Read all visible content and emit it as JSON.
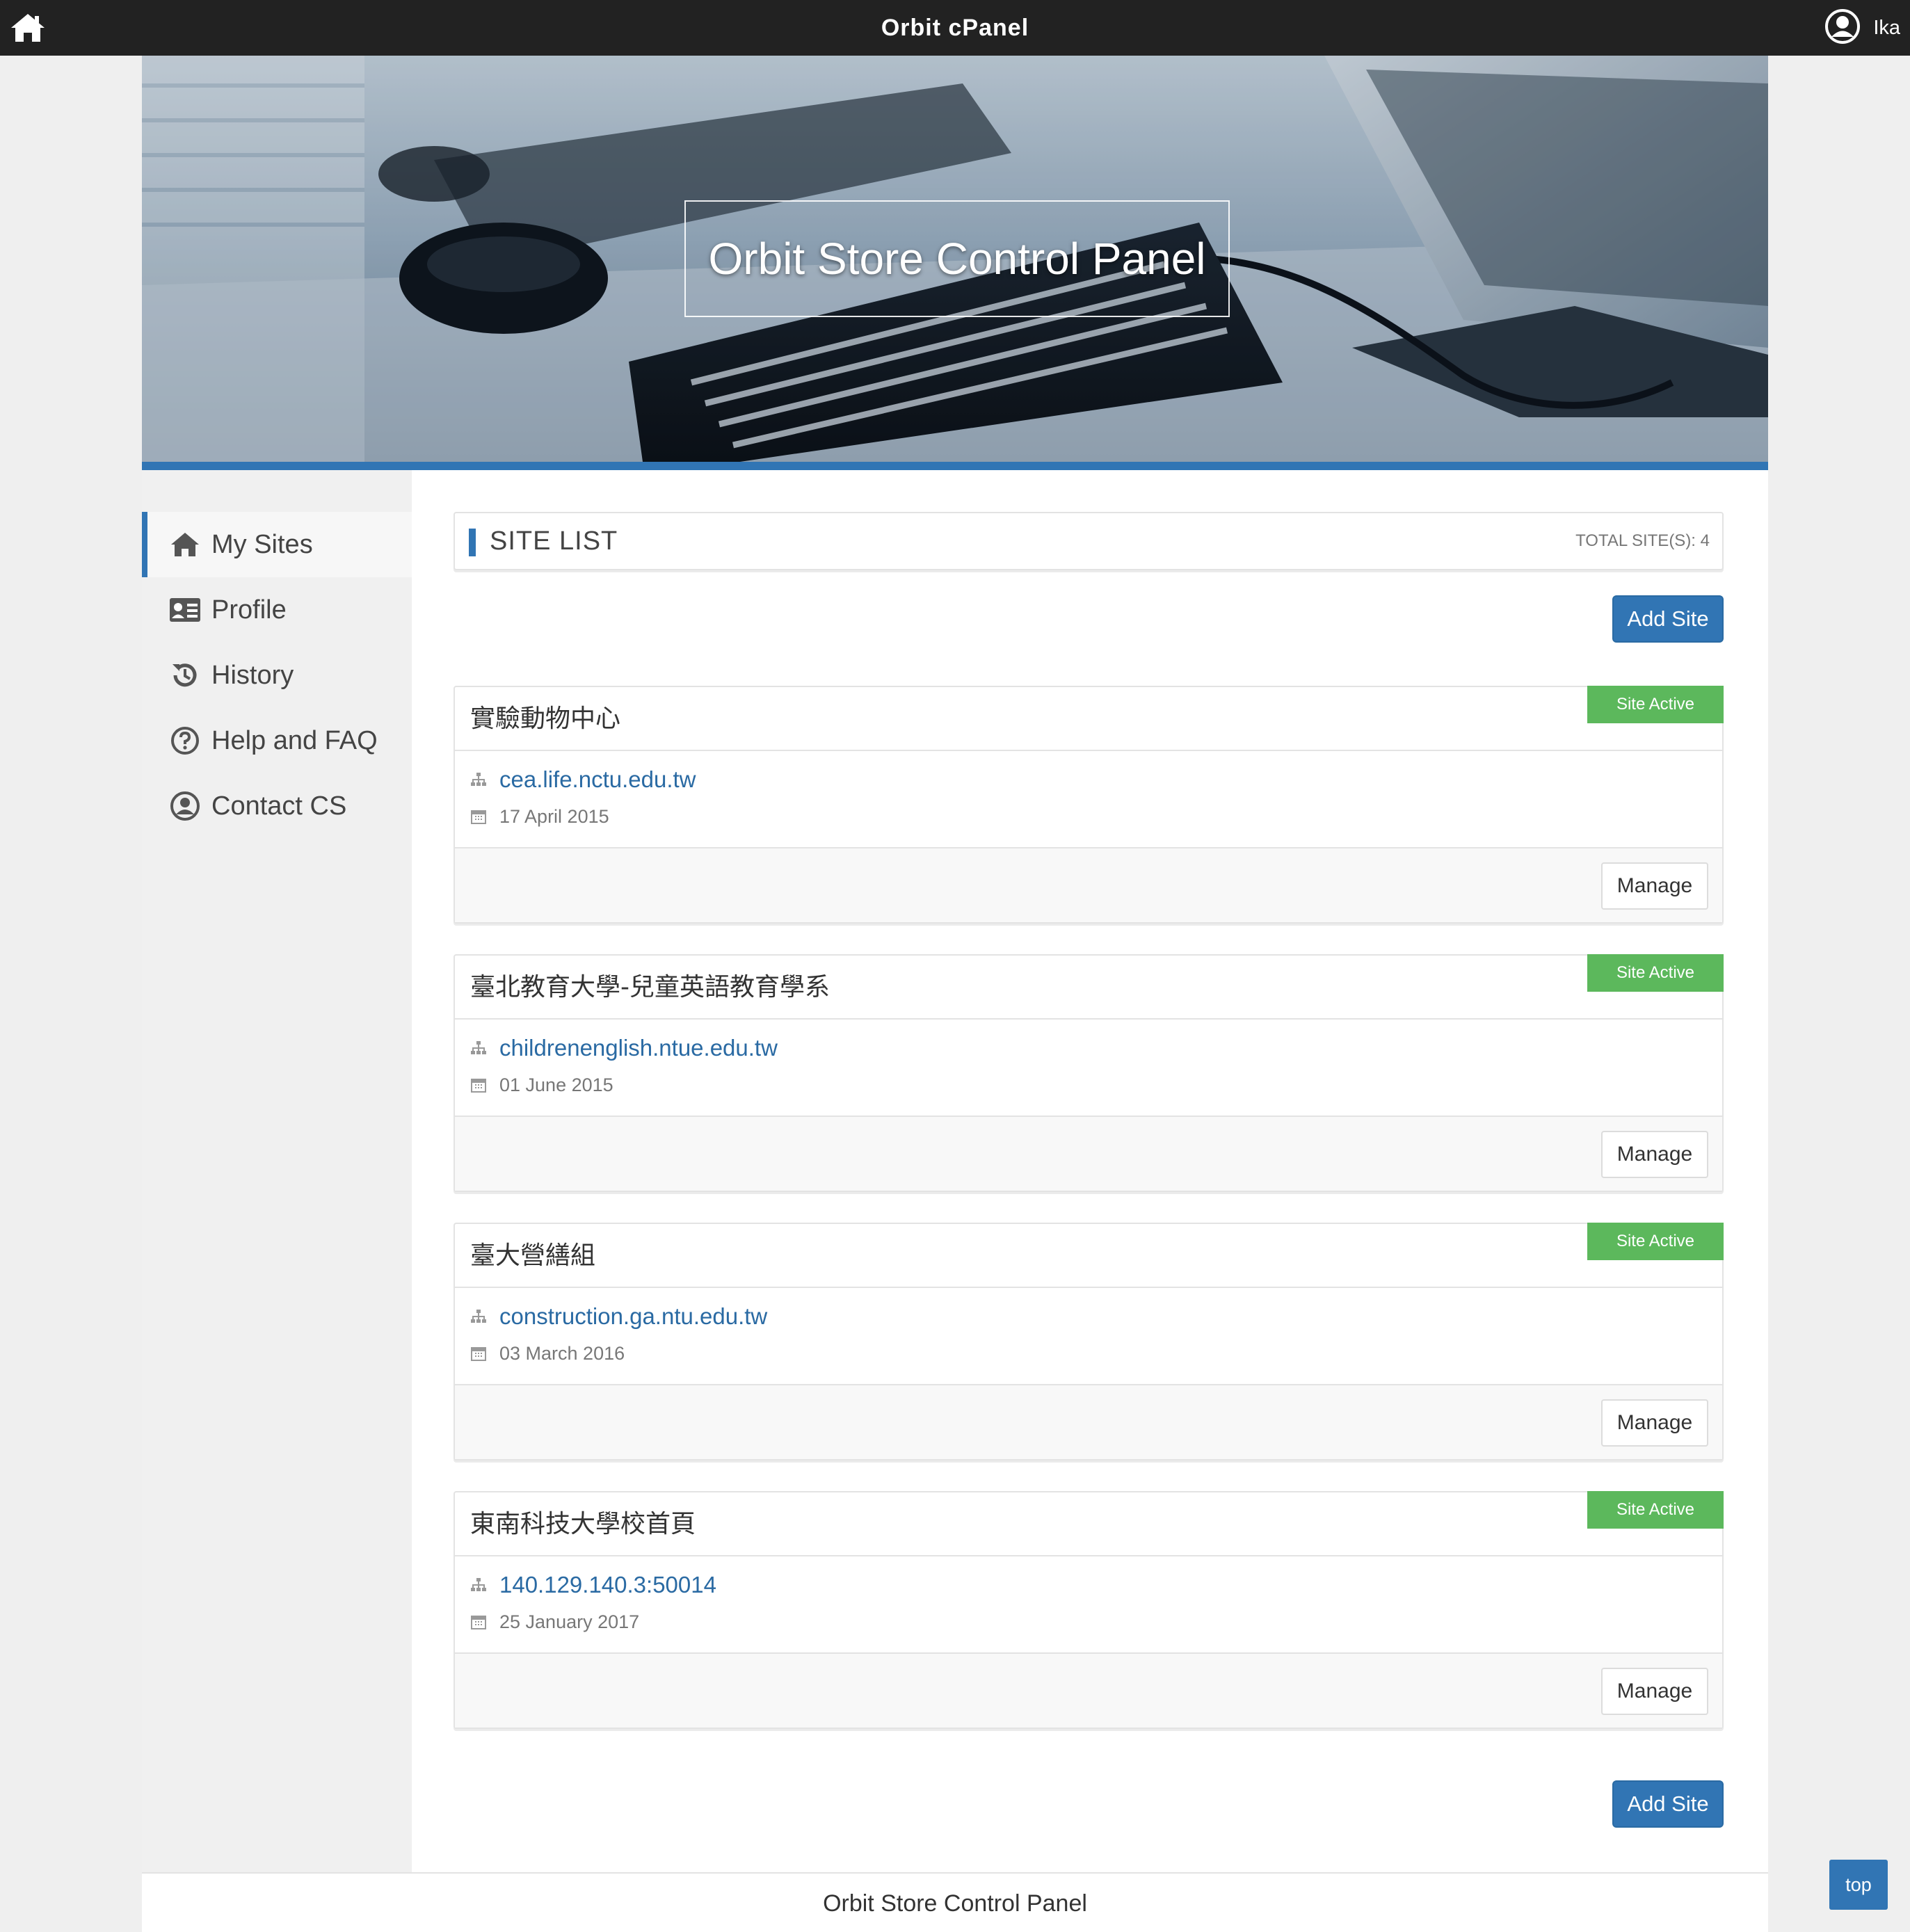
{
  "topbar": {
    "title": "Orbit cPanel",
    "user_name": "Ika",
    "home_icon": "home-icon",
    "user_icon": "user-circle-icon"
  },
  "banner": {
    "title": "Orbit Store Control Panel"
  },
  "sidebar": {
    "items": [
      {
        "label": "My Sites",
        "icon": "home-icon",
        "active": true
      },
      {
        "label": "Profile",
        "icon": "id-card-icon",
        "active": false
      },
      {
        "label": "History",
        "icon": "history-icon",
        "active": false
      },
      {
        "label": "Help and FAQ",
        "icon": "question-circle-icon",
        "active": false
      },
      {
        "label": "Contact CS",
        "icon": "user-circle-icon",
        "active": false
      }
    ]
  },
  "site_list": {
    "heading": "SITE LIST",
    "total": "TOTAL SITE(S): 4",
    "add_label": "Add Site",
    "sites": [
      {
        "name": "實驗動物中心",
        "status": "Site Active",
        "domain": "cea.life.nctu.edu.tw",
        "date": "17 April 2015",
        "manage_label": "Manage"
      },
      {
        "name": "臺北教育大學-兒童英語教育學系",
        "status": "Site Active",
        "domain": "childrenenglish.ntue.edu.tw",
        "date": "01 June 2015",
        "manage_label": "Manage"
      },
      {
        "name": "臺大營繕組",
        "status": "Site Active",
        "domain": "construction.ga.ntu.edu.tw",
        "date": "03 March 2016",
        "manage_label": "Manage"
      },
      {
        "name": "東南科技大學校首頁",
        "status": "Site Active",
        "domain": "140.129.140.3:50014",
        "date": "25 January 2017",
        "manage_label": "Manage"
      }
    ]
  },
  "footer": {
    "text": "Orbit Store Control Panel",
    "top_label": "top"
  },
  "colors": {
    "accent": "#3175b4",
    "active_badge": "#5cb85c",
    "topbar": "#222222",
    "link": "#2a6aa3"
  }
}
